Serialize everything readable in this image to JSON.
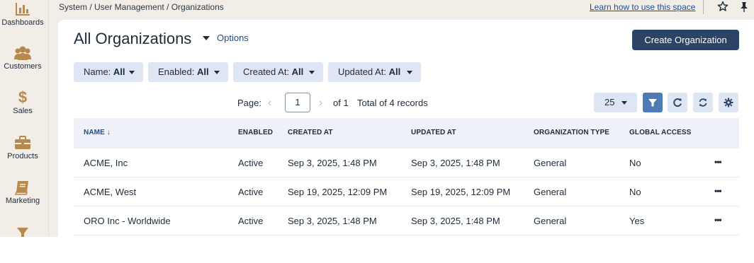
{
  "sidebar": {
    "items": [
      {
        "label": "Dashboards",
        "icon": "bar-chart-icon"
      },
      {
        "label": "Customers",
        "icon": "users-icon"
      },
      {
        "label": "Sales",
        "icon": "dollar-icon"
      },
      {
        "label": "Products",
        "icon": "briefcase-icon"
      },
      {
        "label": "Marketing",
        "icon": "book-icon"
      },
      {
        "label": "",
        "icon": "funnel-icon"
      }
    ]
  },
  "topbar": {
    "breadcrumb": "System / User Management / Organizations",
    "learn_link": "Learn how to use this space"
  },
  "header": {
    "title": "All Organizations",
    "options_label": "Options",
    "create_button": "Create Organization"
  },
  "filters": [
    {
      "label": "Name:",
      "value": "All"
    },
    {
      "label": "Enabled:",
      "value": "All"
    },
    {
      "label": "Created At:",
      "value": "All"
    },
    {
      "label": "Updated At:",
      "value": "All"
    }
  ],
  "pager": {
    "page_label": "Page:",
    "current_page": "1",
    "of_label": "of 1",
    "total_label": "Total of 4 records",
    "page_size": "25"
  },
  "table": {
    "columns": [
      "NAME",
      "ENABLED",
      "CREATED AT",
      "UPDATED AT",
      "ORGANIZATION TYPE",
      "GLOBAL ACCESS"
    ],
    "sort_indicator": "↓",
    "rows": [
      {
        "name": "ACME, Inc",
        "enabled": "Active",
        "created": "Sep 3, 2025, 1:48 PM",
        "updated": "Sep 3, 2025, 1:48 PM",
        "type": "General",
        "global": "No",
        "actions": "•••"
      },
      {
        "name": "ACME, West",
        "enabled": "Active",
        "created": "Sep 19, 2025, 12:09 PM",
        "updated": "Sep 19, 2025, 12:09 PM",
        "type": "General",
        "global": "No",
        "actions": "•••"
      },
      {
        "name": "ORO Inc - Worldwide",
        "enabled": "Active",
        "created": "Sep 3, 2025, 1:48 PM",
        "updated": "Sep 3, 2025, 1:48 PM",
        "type": "General",
        "global": "Yes",
        "actions": "•••"
      }
    ]
  },
  "colors": {
    "accent": "#2b4465",
    "link": "#1f4c8f",
    "filter_bg": "#dde6f2",
    "sidebar_icon": "#b7894c",
    "background": "#f2ede6"
  }
}
